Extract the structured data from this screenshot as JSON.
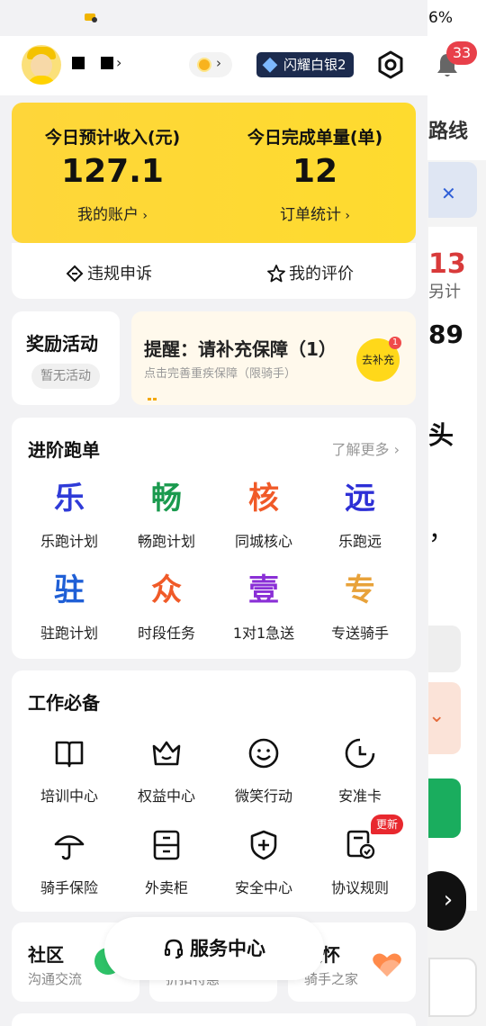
{
  "background": {
    "battery": "6%",
    "notification_count": "33",
    "route_text": "路线",
    "amount_13": "13",
    "side_text_1": "另计",
    "amount_89": "89",
    "side_text_2": "头",
    "side_text_3": "，"
  },
  "profile": {
    "name_arrow": "›",
    "medal_chevron": "›",
    "rank": "闪耀白银2"
  },
  "income": {
    "income_title": "今日预计收入(元)",
    "income_value": "127.1",
    "income_link": "我的账户",
    "orders_title": "今日完成单量(单)",
    "orders_value": "12",
    "orders_link": "订单统计"
  },
  "quick": {
    "appeal": "违规申诉",
    "rating": "我的评价"
  },
  "reward": {
    "title": "奖励活动",
    "empty": "暂无活动"
  },
  "reminder": {
    "title": "提醒：请补充保障（1）",
    "subtitle": "点击完善重疾保障（限骑手）",
    "button": "去补充",
    "badge": "1"
  },
  "advanced": {
    "title": "进阶跑单",
    "more": "了解更多",
    "items": [
      {
        "char": "乐",
        "label": "乐跑计划",
        "color": "#2f3bd8"
      },
      {
        "char": "畅",
        "label": "畅跑计划",
        "color": "#1a9a4e"
      },
      {
        "char": "核",
        "label": "同城核心",
        "color": "#f05a28"
      },
      {
        "char": "远",
        "label": "乐跑远",
        "color": "#2d2fd6"
      },
      {
        "char": "驻",
        "label": "驻跑计划",
        "color": "#1f5fd6"
      },
      {
        "char": "众",
        "label": "时段任务",
        "color": "#f05a28"
      },
      {
        "char": "壹",
        "label": "1对1急送",
        "color": "#8a2fd6"
      },
      {
        "char": "专",
        "label": "专送骑手",
        "color": "#e8a23a"
      }
    ]
  },
  "work": {
    "title": "工作必备",
    "items": [
      {
        "label": "培训中心",
        "icon": "book-icon"
      },
      {
        "label": "权益中心",
        "icon": "crown-icon"
      },
      {
        "label": "微笑行动",
        "icon": "smile-icon"
      },
      {
        "label": "安准卡",
        "icon": "clock-card-icon"
      },
      {
        "label": "骑手保险",
        "icon": "umbrella-icon"
      },
      {
        "label": "外卖柜",
        "icon": "cabinet-icon"
      },
      {
        "label": "安全中心",
        "icon": "shield-icon"
      },
      {
        "label": "协议规则",
        "icon": "agreement-icon"
      }
    ],
    "update_badge": "更新"
  },
  "bottom": {
    "community_title": "社区",
    "community_sub": "沟通交流",
    "middle_sub": "折扣特惠",
    "care_title": "关怀",
    "care_sub": "骑手之家",
    "service_center": "服务中心"
  }
}
